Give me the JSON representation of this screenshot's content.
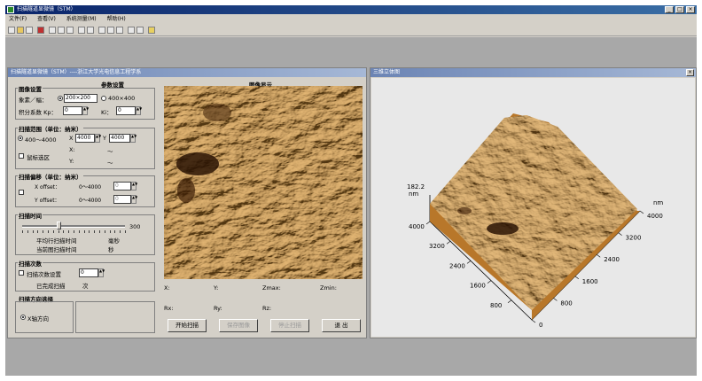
{
  "app": {
    "title": "扫描隧道显微镜（STM）"
  },
  "menu": [
    "文件(F)",
    "查看(V)",
    "系统测量(M)",
    "帮助(H)"
  ],
  "left_window": {
    "title": "扫描隧道显微镜（STM）----浙江大学光电信息工程学系",
    "param_header": "参数设置",
    "image_header": "图像显示",
    "image_settings": {
      "label": "图像设置",
      "pixel_label": "象素／幅：",
      "option_200": "200×200",
      "option_400": "400×400",
      "gain_label": "积分系数 Kp：",
      "kp_value": "0",
      "ki_label": "Ki：",
      "ki_value": "0"
    },
    "scan_range": {
      "label": "扫描范围（单位：纳米）",
      "range": "400～4000",
      "x_mark": "X",
      "x_value": "4000",
      "y_mark": "Y",
      "y_value": "4000",
      "mouse_select": "鼠标选区",
      "x_label": "X:",
      "y_label": "Y:",
      "tilde": "～"
    },
    "scan_offset": {
      "label": "扫描偏移（单位：纳米）",
      "xoffset_label": "X offset：",
      "xoffset_range": "0～4000",
      "xoffset_value": "0",
      "yoffset_label": "Y offset：",
      "yoffset_range": "0～4000",
      "yoffset_value": "0"
    },
    "scan_time": {
      "label": "扫描时间",
      "slider_max": "300",
      "slider_level": 0.35,
      "avg_label": "平均行扫描时间",
      "avg_unit": "毫秒",
      "cur_label": "当前图扫描时间",
      "cur_unit": "秒"
    },
    "scan_count": {
      "label": "扫描次数",
      "set_label": "扫描次数设置",
      "set_value": "0",
      "done_label": "已完成扫描",
      "done_unit": "次"
    },
    "scan_direction": {
      "label": "扫描方向选择",
      "option": "X轴方向"
    },
    "readouts": {
      "x": "X:",
      "y": "Y:",
      "zmax": "Zmax:",
      "zmin": "Zmin:",
      "rx": "Rx:",
      "ry": "Ry:",
      "rz": "Rz:"
    },
    "buttons": {
      "start": "开始扫描",
      "save": "保存图像",
      "stop": "停止扫描",
      "exit": "退 出"
    }
  },
  "right_window": {
    "title": "三维立体图",
    "z_label": "182.2\nnm",
    "unit_label": "nm",
    "right_ticks": [
      "4000",
      "3200",
      "2400",
      "1600",
      "800",
      "0"
    ],
    "left_ticks": [
      "4000",
      "3200",
      "2400",
      "1600",
      "800"
    ]
  },
  "colors": {
    "surface_light": "#f1cf9a",
    "surface_mid": "#c6862f",
    "surface_dark": "#4a2606"
  }
}
